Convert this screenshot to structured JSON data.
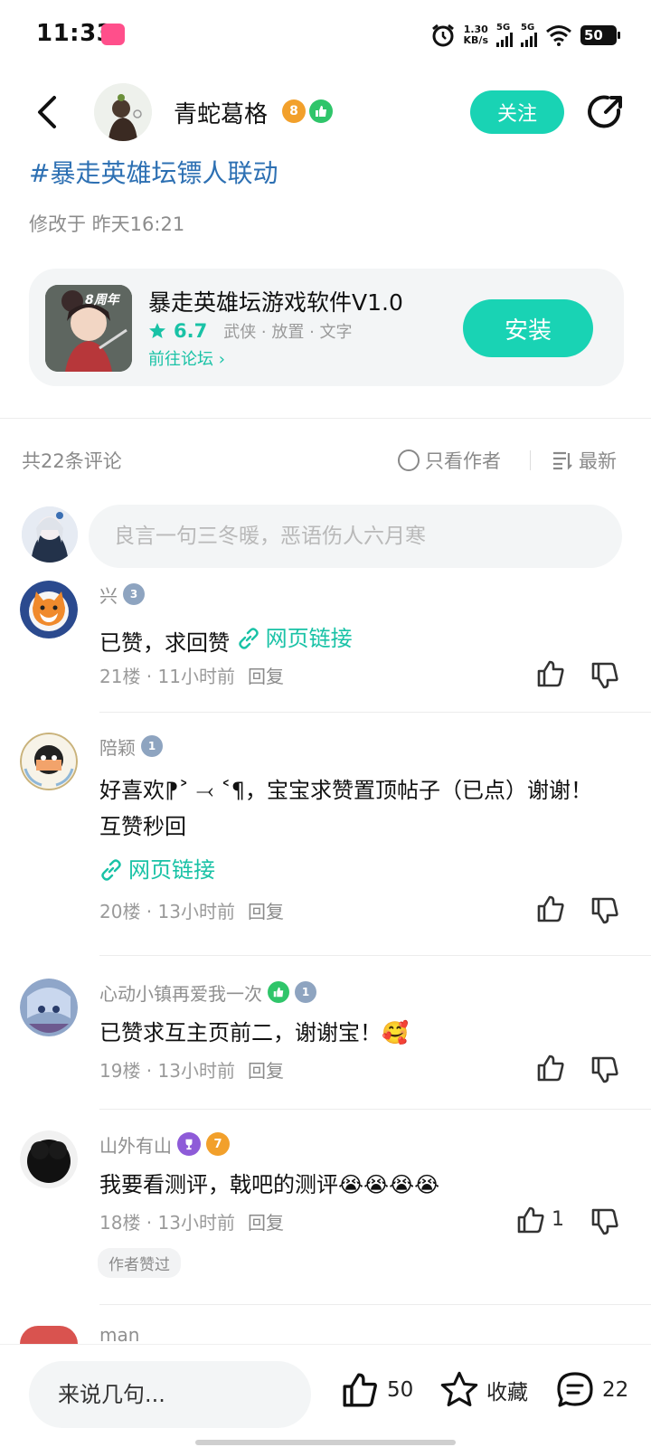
{
  "status_bar": {
    "time": "11:33",
    "net_speed_value": "1.30",
    "net_speed_unit": "KB/s",
    "sim1": "5G",
    "sim2": "5G",
    "battery": "50"
  },
  "header": {
    "author_name": "青蛇葛格",
    "author_level": "8",
    "follow_label": "关注"
  },
  "post": {
    "hashtag": "#暴走英雄坛镖人联动",
    "modified": "修改于 昨天16:21"
  },
  "game_card": {
    "icon_text": "8周年",
    "title": "暴走英雄坛游戏软件V1.0",
    "rating": "6.7",
    "tags": "武侠 · 放置 · 文字",
    "forum_link": "前往论坛",
    "install_label": "安装"
  },
  "comments_bar": {
    "count": "共22条评论",
    "only_author": "只看作者",
    "sort": "最新"
  },
  "comment_input": {
    "placeholder": "良言一句三冬暖，恶语伤人六月寒"
  },
  "comments": [
    {
      "name": "兴",
      "level": "3",
      "text": "已赞，求回赞",
      "link": "网页链接",
      "floor": "21楼",
      "time": "11小时前",
      "reply": "回复"
    },
    {
      "name": "陪颖",
      "level": "1",
      "text": "好喜欢⁋˃ ⤙ ˂¶，宝宝求赞置顶帖子（已点）谢谢！ 互赞秒回",
      "link": "网页链接",
      "floor": "20楼",
      "time": "13小时前",
      "reply": "回复"
    },
    {
      "name": "心动小镇再爱我一次",
      "level": "1",
      "text": "已赞求互主页前二，谢谢宝！",
      "emoji": "🥰",
      "floor": "19楼",
      "time": "13小时前",
      "reply": "回复"
    },
    {
      "name": "山外有山",
      "level": "7",
      "text": "我要看测评，戟吧的测评",
      "emoji": "😭😭😭😭",
      "floor": "18楼",
      "time": "13小时前",
      "reply": "回复",
      "likes": "1",
      "author_liked": "作者赞过"
    },
    {
      "name": "man"
    }
  ],
  "bottom_bar": {
    "input_placeholder": "来说几句...",
    "likes": "50",
    "favorite": "收藏",
    "comments": "22"
  },
  "colors": {
    "accent": "#19d3b4",
    "link_blue": "#2d70b3",
    "level_gray": "#8ea4c0",
    "level_orange": "#f2a02b",
    "badge_green": "#2fc56a",
    "badge_purple": "#8e5bd8"
  }
}
